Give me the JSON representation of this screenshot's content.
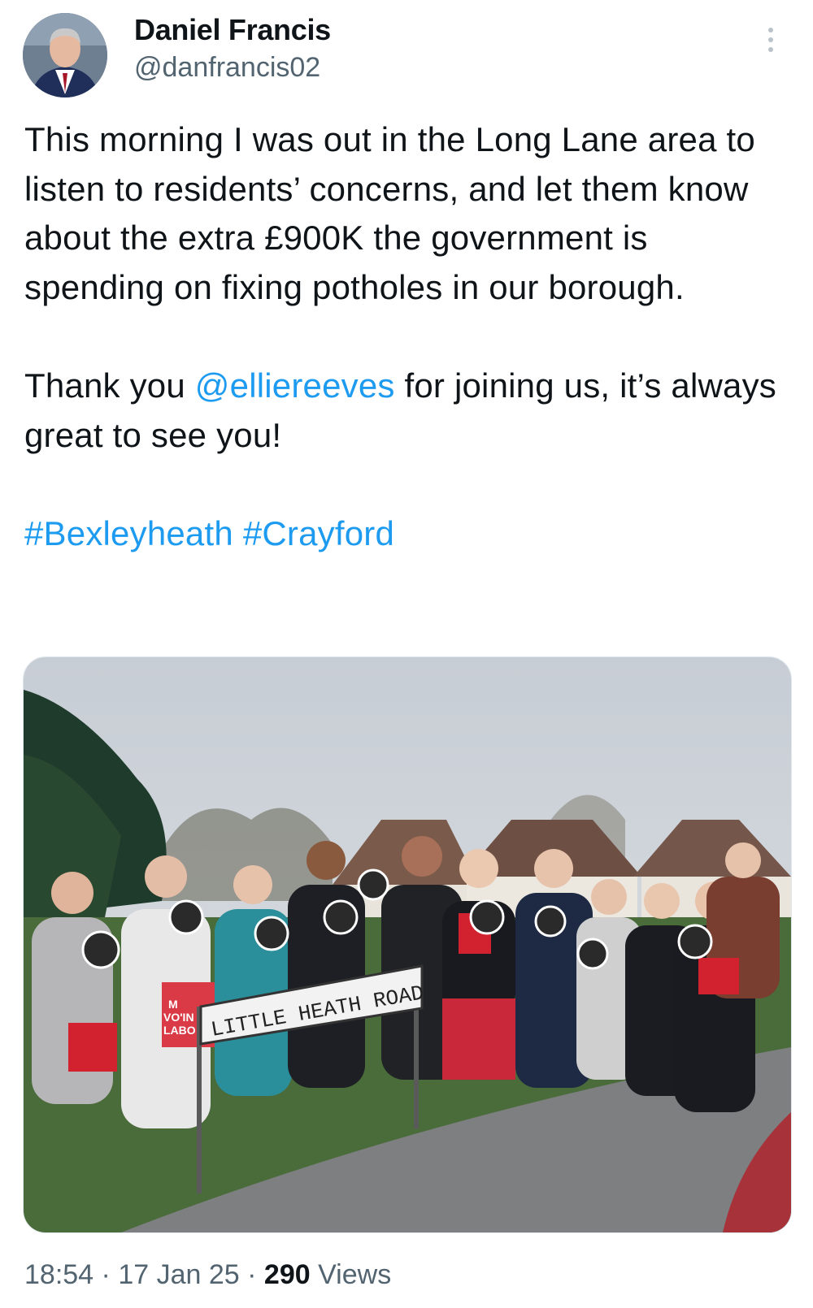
{
  "author": {
    "display_name": "Daniel Francis",
    "handle": "@danfrancis02",
    "avatar_icon": "profile-photo"
  },
  "tweet": {
    "para1": "This morning I was out in the Long Lane area to listen to residents’ concerns, and let them know about the extra £900K the government is spending on fixing potholes in our borough.",
    "para2_before": "Thank you ",
    "mention": "@elliereeves",
    "para2_after": " for joining us, it’s always great to see you!",
    "hashtag1": "#Bexleyheath",
    "hashtag2": "#Crayford",
    "link_color": "#1d9bf0"
  },
  "photo": {
    "sign_text": "LITTLE HEATH ROAD",
    "bag_text_1": "M",
    "bag_text_2": "VO'IN",
    "bag_text_3": "LABO"
  },
  "meta": {
    "time": "18:54",
    "date": "17 Jan 25",
    "views_count": "290",
    "views_label": "Views",
    "separator": "·"
  }
}
